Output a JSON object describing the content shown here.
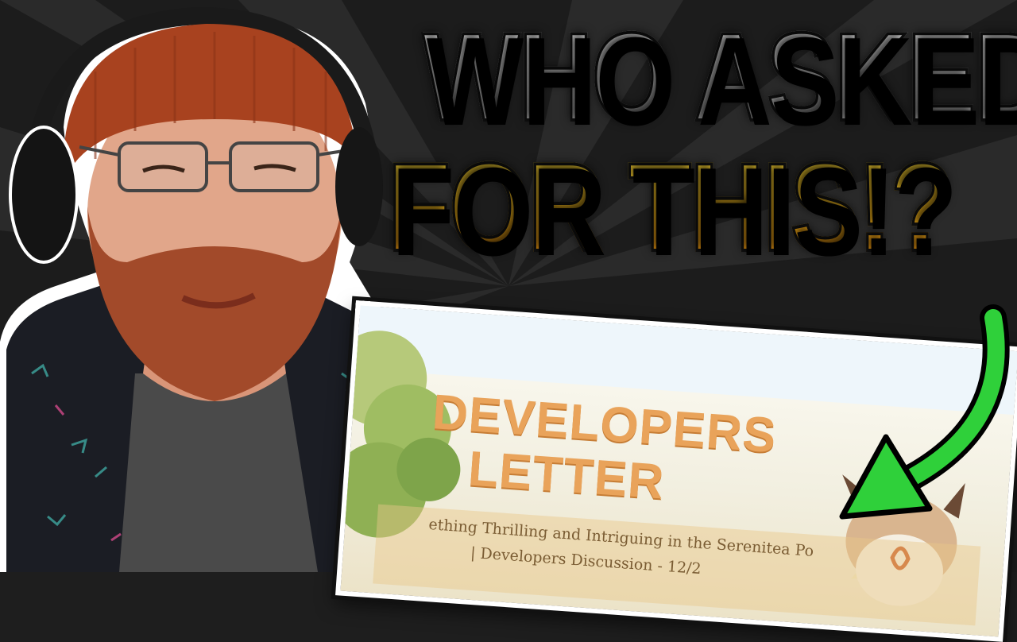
{
  "headline": {
    "line1": "WHO ASKED",
    "line2": "FOR THIS",
    "line3": "!?"
  },
  "letter": {
    "title_line1": "DEVELOPERS",
    "title_line2": "LETTER",
    "subtitle_line1": "ething Thrilling and Intriguing in the Serenitea Po",
    "subtitle_line2": "| Developers Discussion - 12/2"
  },
  "colors": {
    "headline_top": "#e6e6e6",
    "headline_accent": "#ffc21a",
    "arrow": "#22c72e",
    "beanie": "#a8421f",
    "letter_title": "#e9a35a"
  },
  "icons": [
    "green-curved-arrow-icon"
  ]
}
